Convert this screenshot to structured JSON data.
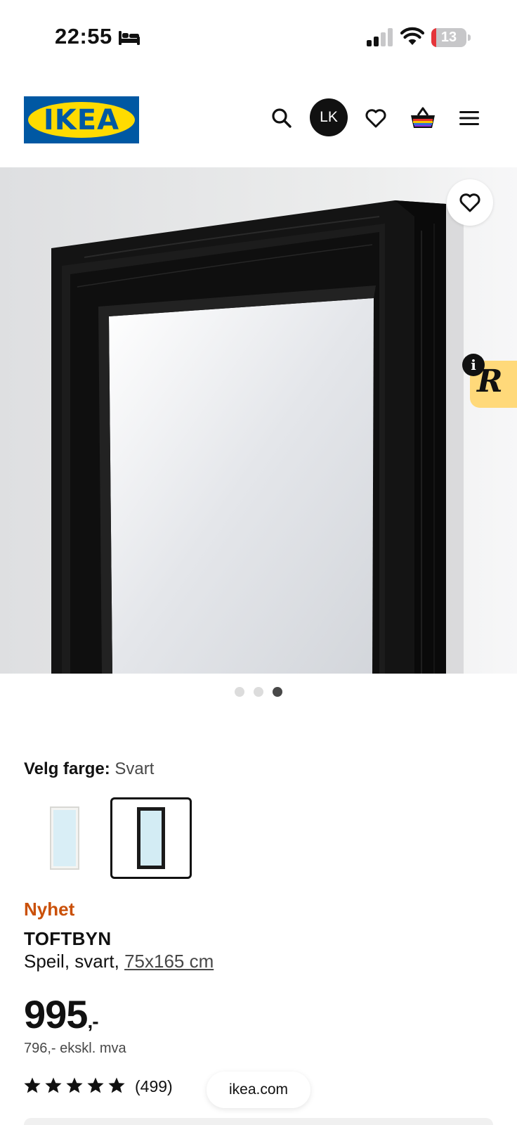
{
  "status_bar": {
    "time": "22:55",
    "battery_level": "13",
    "battery_fraction": 0.13
  },
  "header": {
    "logo_text": "IKEA",
    "avatar_initials": "LK",
    "icons": [
      "search-icon",
      "heart-icon",
      "basket-icon",
      "menu-icon"
    ]
  },
  "gallery": {
    "image_count": 3,
    "active_index": 2
  },
  "extension_badge": {
    "letter": "R",
    "info": "i"
  },
  "color_select": {
    "label": "Velg farge:",
    "value": "Svart",
    "options": [
      "white",
      "black"
    ],
    "selected_index": 1
  },
  "product": {
    "badge": "Nyhet",
    "name": "TOFTBYN",
    "description": "Speil, svart, ",
    "size": "75x165 cm",
    "price": "995",
    "price_suffix": ",-",
    "price_excl_vat": "796,- ekskl. mva",
    "rating": 5,
    "review_count": "(499)"
  },
  "browser": {
    "url": "ikea.com"
  },
  "colors": {
    "ikea_blue": "#0058a3",
    "ikea_yellow": "#ffdb00",
    "new_badge": "#ca5008",
    "text": "#111111",
    "muted": "#484848"
  }
}
